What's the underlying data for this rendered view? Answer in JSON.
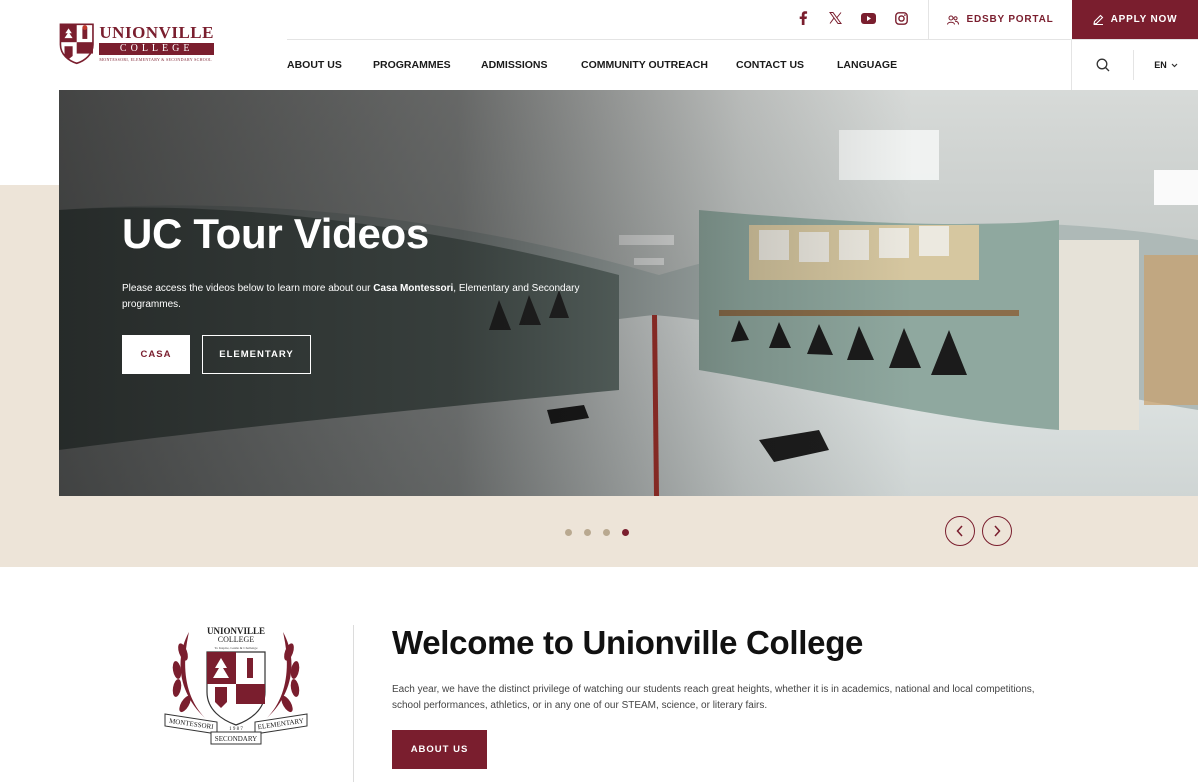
{
  "brand": {
    "name_line1": "UNIONVILLE",
    "name_line2": "COLLEGE",
    "tagline": "MONTESSORI, ELEMENTARY & SECONDARY SCHOOL",
    "accent_color": "#7a1e2e",
    "beige_color": "#ede4d8"
  },
  "social": [
    {
      "icon": "facebook-icon"
    },
    {
      "icon": "x-twitter-icon"
    },
    {
      "icon": "youtube-icon"
    },
    {
      "icon": "instagram-icon"
    }
  ],
  "utility": {
    "portal_label": "EDSBY PORTAL",
    "apply_label": "APPLY NOW"
  },
  "nav": {
    "items": [
      "ABOUT US",
      "PROGRAMMES",
      "ADMISSIONS",
      "COMMUNITY OUTREACH",
      "CONTACT US",
      "LANGUAGE"
    ],
    "language_value": "EN"
  },
  "hero": {
    "title": "UC Tour Videos",
    "text_before": "Please access the videos below to learn more about our ",
    "text_bold": "Casa Montessori",
    "text_after": ", Elementary and Secondary programmes.",
    "btn_casa": "CASA",
    "btn_elementary": "ELEMENTARY",
    "slide_count": 4,
    "active_slide": 4
  },
  "crest": {
    "top1": "UNIONVILLE",
    "top2": "COLLEGE",
    "motto": "To Inspire, Guide & Challenge",
    "ribbon_left": "MONTESSORI",
    "ribbon_right": "ELEMENTARY",
    "ribbon_bottom": "SECONDARY",
    "year_digits": "1 9 8 7"
  },
  "welcome": {
    "title": "Welcome to Unionville College",
    "text": "Each year, we have the distinct privilege of watching our students reach great heights, whether it is in academics, national and local competitions, school performances, athletics, or in any one of our STEAM, science, or literary fairs.",
    "button": "ABOUT US"
  }
}
